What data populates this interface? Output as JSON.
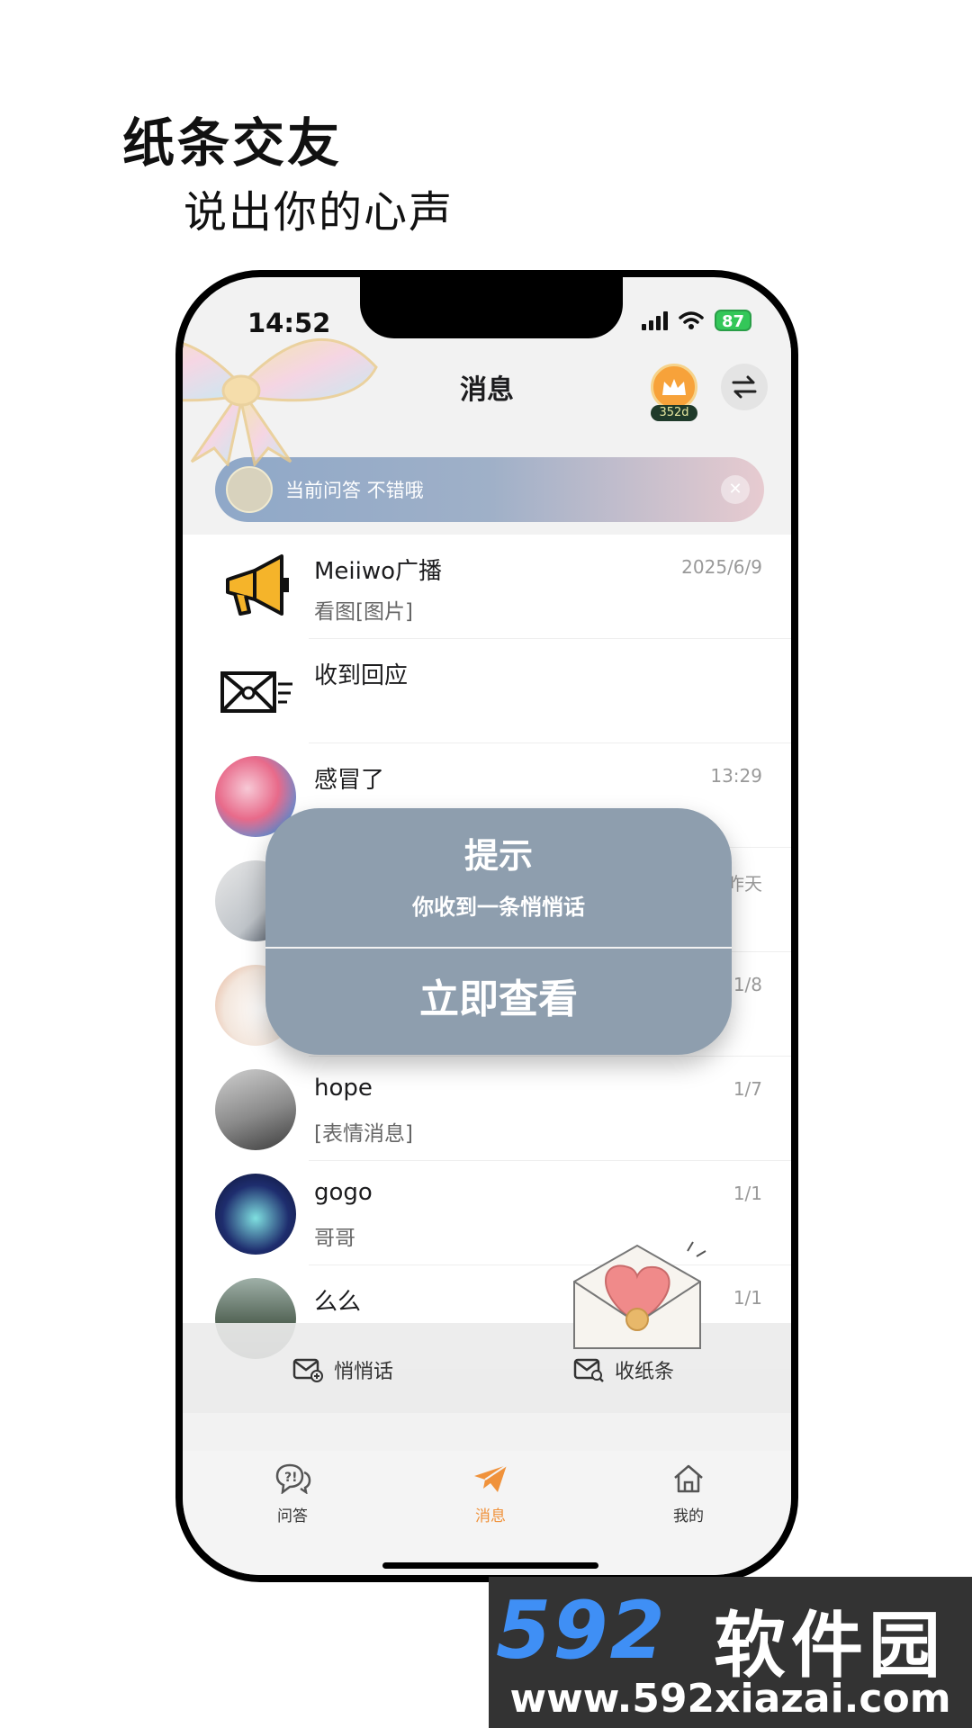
{
  "promo": {
    "headline": "纸条交友",
    "subline": "说出你的心声"
  },
  "status_bar": {
    "time": "14:52",
    "battery": "87"
  },
  "header": {
    "title": "消息",
    "vip_days": "352d"
  },
  "notice": {
    "text": "当前问答   不错哦",
    "close": "✕"
  },
  "messages": [
    {
      "name": "Meiiwo广播",
      "preview": "看图[图片]",
      "time": "2025/6/9"
    },
    {
      "name": "收到回应",
      "preview": "",
      "time": ""
    },
    {
      "name": "感冒了",
      "preview": "",
      "time": "13:29"
    },
    {
      "name": "",
      "preview": "",
      "time": "昨天"
    },
    {
      "name": "",
      "preview": "",
      "time": "1/8"
    },
    {
      "name": "hope",
      "preview": "[表情消息]",
      "time": "1/7"
    },
    {
      "name": "gogo",
      "preview": "哥哥",
      "time": "1/1"
    },
    {
      "name": "么么",
      "preview": "",
      "time": "1/1"
    }
  ],
  "dialog": {
    "title": "提示",
    "message": "你收到一条悄悄话",
    "button": "立即查看"
  },
  "actions": {
    "whisper": "悄悄话",
    "receive": "收纸条"
  },
  "tabs": {
    "qa": "问答",
    "messages": "消息",
    "mine": "我的"
  },
  "watermark": {
    "logo": "592",
    "name": "软件园",
    "url": "www.592xiazai.com"
  },
  "colors": {
    "accent": "#f0923b",
    "dialog": "#8e9eae",
    "vip": "#f7a23a"
  }
}
